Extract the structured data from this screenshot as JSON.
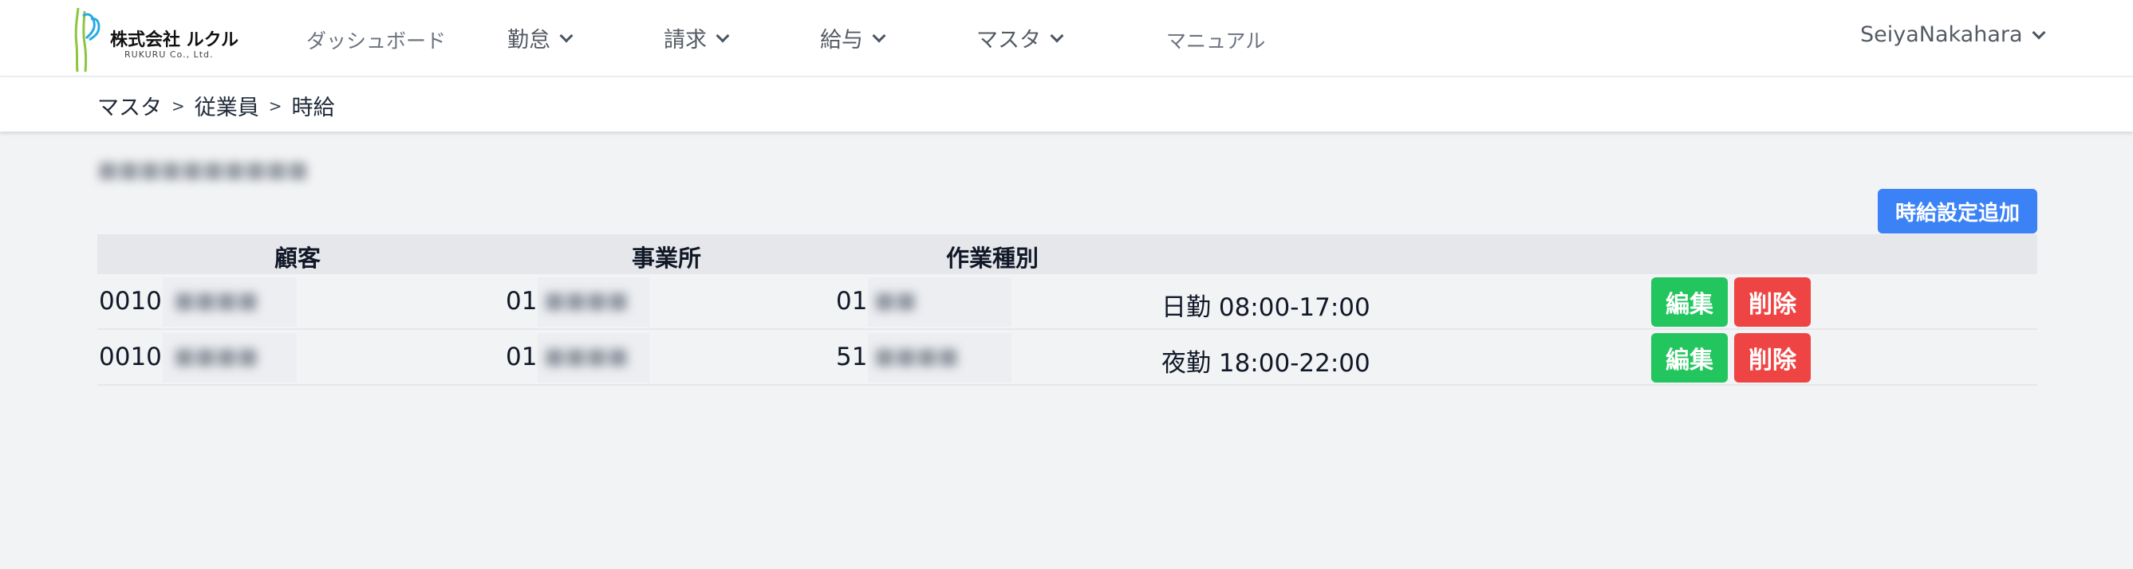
{
  "logo": {
    "company_name": "株式会社 ルクル",
    "company_sub": "RUKURU Co., Ltd."
  },
  "nav": {
    "dashboard": "ダッシュボード",
    "attendance": "勤怠",
    "billing": "請求",
    "salary": "給与",
    "master": "マスタ",
    "manual": "マニュアル",
    "user": "SeiyaNakahara"
  },
  "breadcrumb": {
    "level1": "マスタ",
    "sep": ">",
    "level2": "従業員",
    "level3": "時給"
  },
  "page": {
    "add_button": "時給設定追加"
  },
  "table": {
    "headers": {
      "customer": "顧客",
      "office": "事業所",
      "work_type": "作業種別"
    },
    "rows": [
      {
        "customer_code": "0010:",
        "office_code": "01:",
        "work_type_code": "01:",
        "shift": "日勤 08:00-17:00",
        "edit": "編集",
        "delete": "削除"
      },
      {
        "customer_code": "0010:",
        "office_code": "01:",
        "work_type_code": "51:",
        "shift": "夜勤 18:00-22:00",
        "edit": "編集",
        "delete": "削除"
      }
    ]
  },
  "colors": {
    "primary": "#3b82f6",
    "edit": "#22c55e",
    "delete": "#ef4444",
    "logo_green": "#8cc63f",
    "logo_blue": "#29abe2"
  }
}
